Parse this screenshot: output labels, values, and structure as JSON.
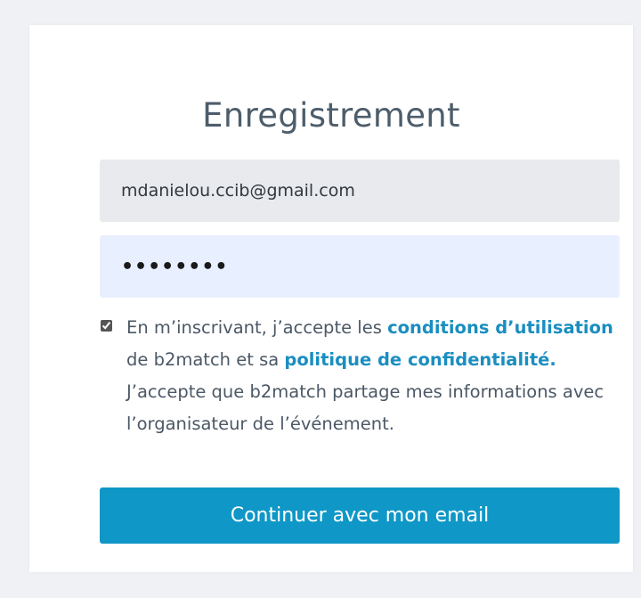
{
  "form": {
    "title": "Enregistrement",
    "email_value": "mdanielou.ccib@gmail.com",
    "password_value": "••••••••",
    "consent_checked": true,
    "consent": {
      "part1": "En m’inscrivant, j’accepte les ",
      "terms_link": "conditions d’utilisation",
      "part2": " de b2match et sa ",
      "privacy_link": "politique de confidentialité.",
      "part3": " J’accepte que b2match partage mes informations avec l’organisateur de l’événement."
    },
    "submit_label": "Continuer avec mon email"
  },
  "colors": {
    "accent": "#0f97c7",
    "link": "#1a8ec0",
    "background": "#eff1f4"
  }
}
